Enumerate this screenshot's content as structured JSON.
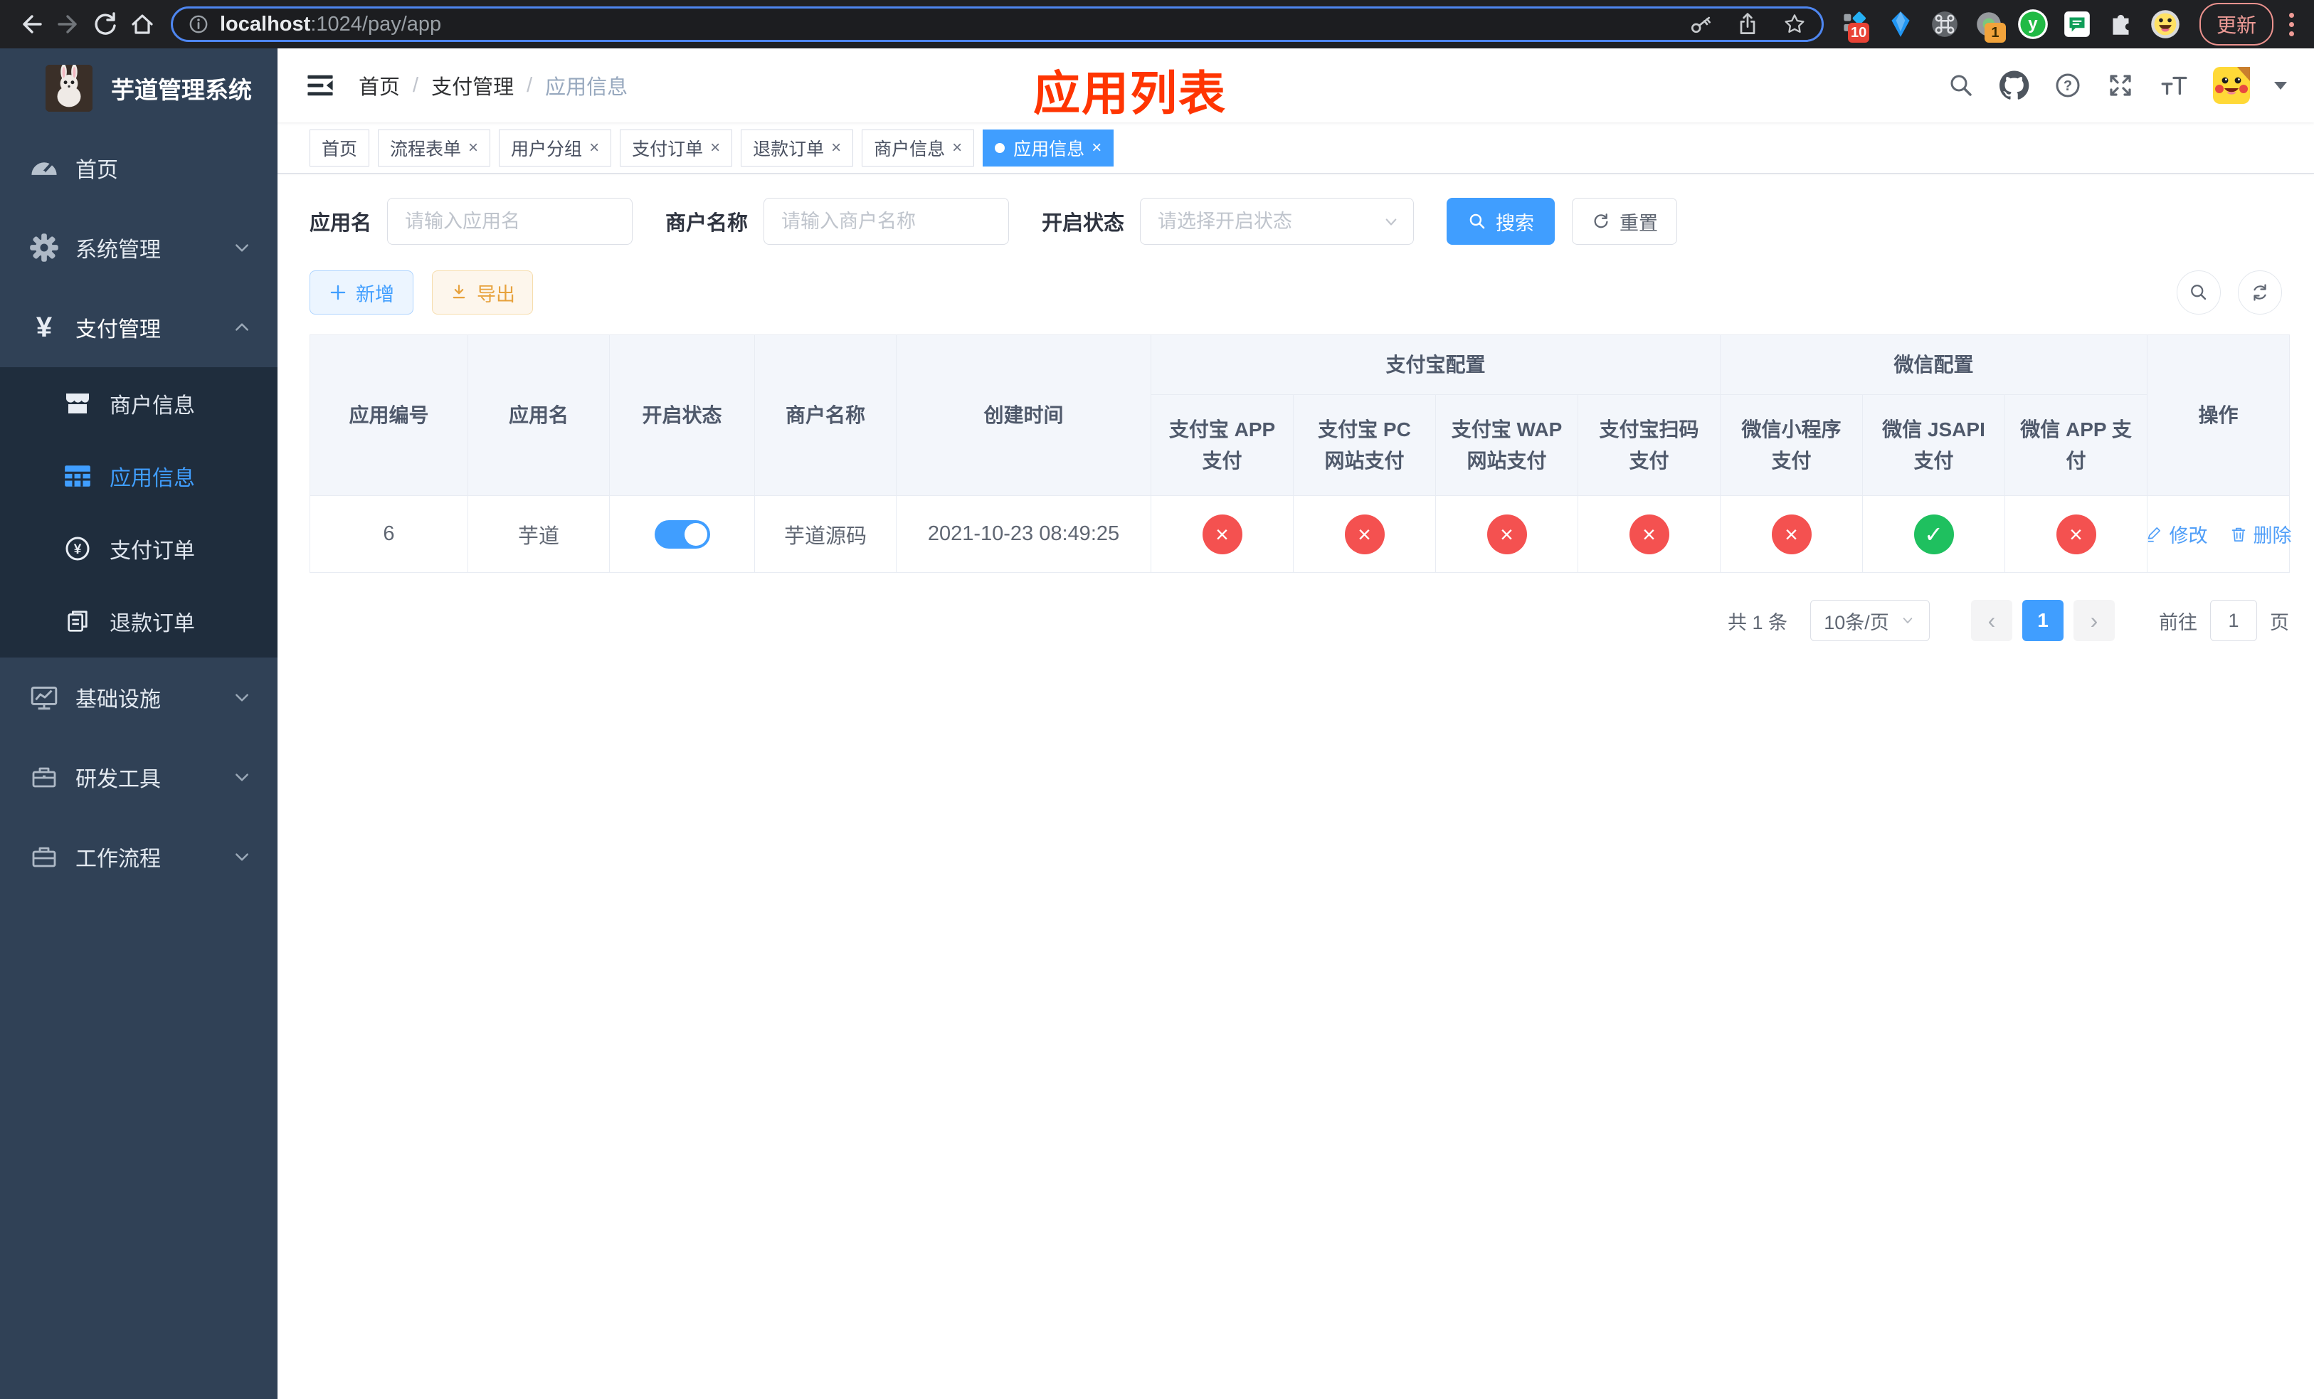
{
  "browser": {
    "url_host": "localhost",
    "url_rest": ":1024/pay/app",
    "update_label": "更新",
    "ext1_badge": "10",
    "ext4_badge": "1",
    "ext5_letter": "y"
  },
  "sidebar": {
    "title": "芋道管理系统",
    "menu": [
      {
        "label": "首页"
      },
      {
        "label": "系统管理"
      },
      {
        "label": "支付管理"
      }
    ],
    "submenu": [
      {
        "label": "商户信息"
      },
      {
        "label": "应用信息"
      },
      {
        "label": "支付订单"
      },
      {
        "label": "退款订单"
      }
    ],
    "menu2": [
      {
        "label": "基础设施"
      },
      {
        "label": "研发工具"
      },
      {
        "label": "工作流程"
      }
    ]
  },
  "header": {
    "breadcrumb": [
      "首页",
      "支付管理",
      "应用信息"
    ],
    "separator": "/",
    "annotation": "应用列表"
  },
  "tabs": [
    {
      "label": "首页"
    },
    {
      "label": "流程表单"
    },
    {
      "label": "用户分组"
    },
    {
      "label": "支付订单"
    },
    {
      "label": "退款订单"
    },
    {
      "label": "商户信息"
    },
    {
      "label": "应用信息"
    }
  ],
  "search": {
    "app_name_label": "应用名",
    "app_name_placeholder": "请输入应用名",
    "merchant_label": "商户名称",
    "merchant_placeholder": "请输入商户名称",
    "status_label": "开启状态",
    "status_placeholder": "请选择开启状态",
    "search_button": "搜索",
    "reset_button": "重置"
  },
  "toolbar": {
    "add_label": "新增",
    "export_label": "导出"
  },
  "table": {
    "col_id": "应用编号",
    "col_name": "应用名",
    "col_status": "开启状态",
    "col_merchant": "商户名称",
    "col_created": "创建时间",
    "group_alipay": "支付宝配置",
    "group_wechat": "微信配置",
    "col_alipay_app": "支付宝 APP 支付",
    "col_alipay_pc": "支付宝 PC 网站支付",
    "col_alipay_wap": "支付宝 WAP 网站支付",
    "col_alipay_qr": "支付宝扫码支付",
    "col_wx_mini": "微信小程序支付",
    "col_wx_jsapi": "微信 JSAPI 支付",
    "col_wx_app": "微信 APP 支付",
    "col_actions": "操作",
    "row": {
      "id": "6",
      "name": "芋道",
      "status_on": true,
      "merchant": "芋道源码",
      "created": "2021-10-23 08:49:25",
      "configs": [
        "no",
        "no",
        "no",
        "no",
        "no",
        "yes",
        "no"
      ],
      "edit": "修改",
      "del": "删除"
    }
  },
  "pagination": {
    "total": "共 1 条",
    "page_size": "10条/页",
    "page": "1",
    "goto_label": "前往",
    "goto_value": "1",
    "page_unit": "页"
  },
  "glyphs": {
    "close": "×",
    "check": "✓",
    "cross": "×",
    "prev": "‹",
    "next": "›",
    "dot": "●"
  },
  "colors": {
    "accent": "#409EFF",
    "danger": "#f45150",
    "success": "#1fc05f",
    "annotation": "#ff3502",
    "sidebar_bg": "#304156",
    "submenu_bg": "#1f2d3d"
  }
}
